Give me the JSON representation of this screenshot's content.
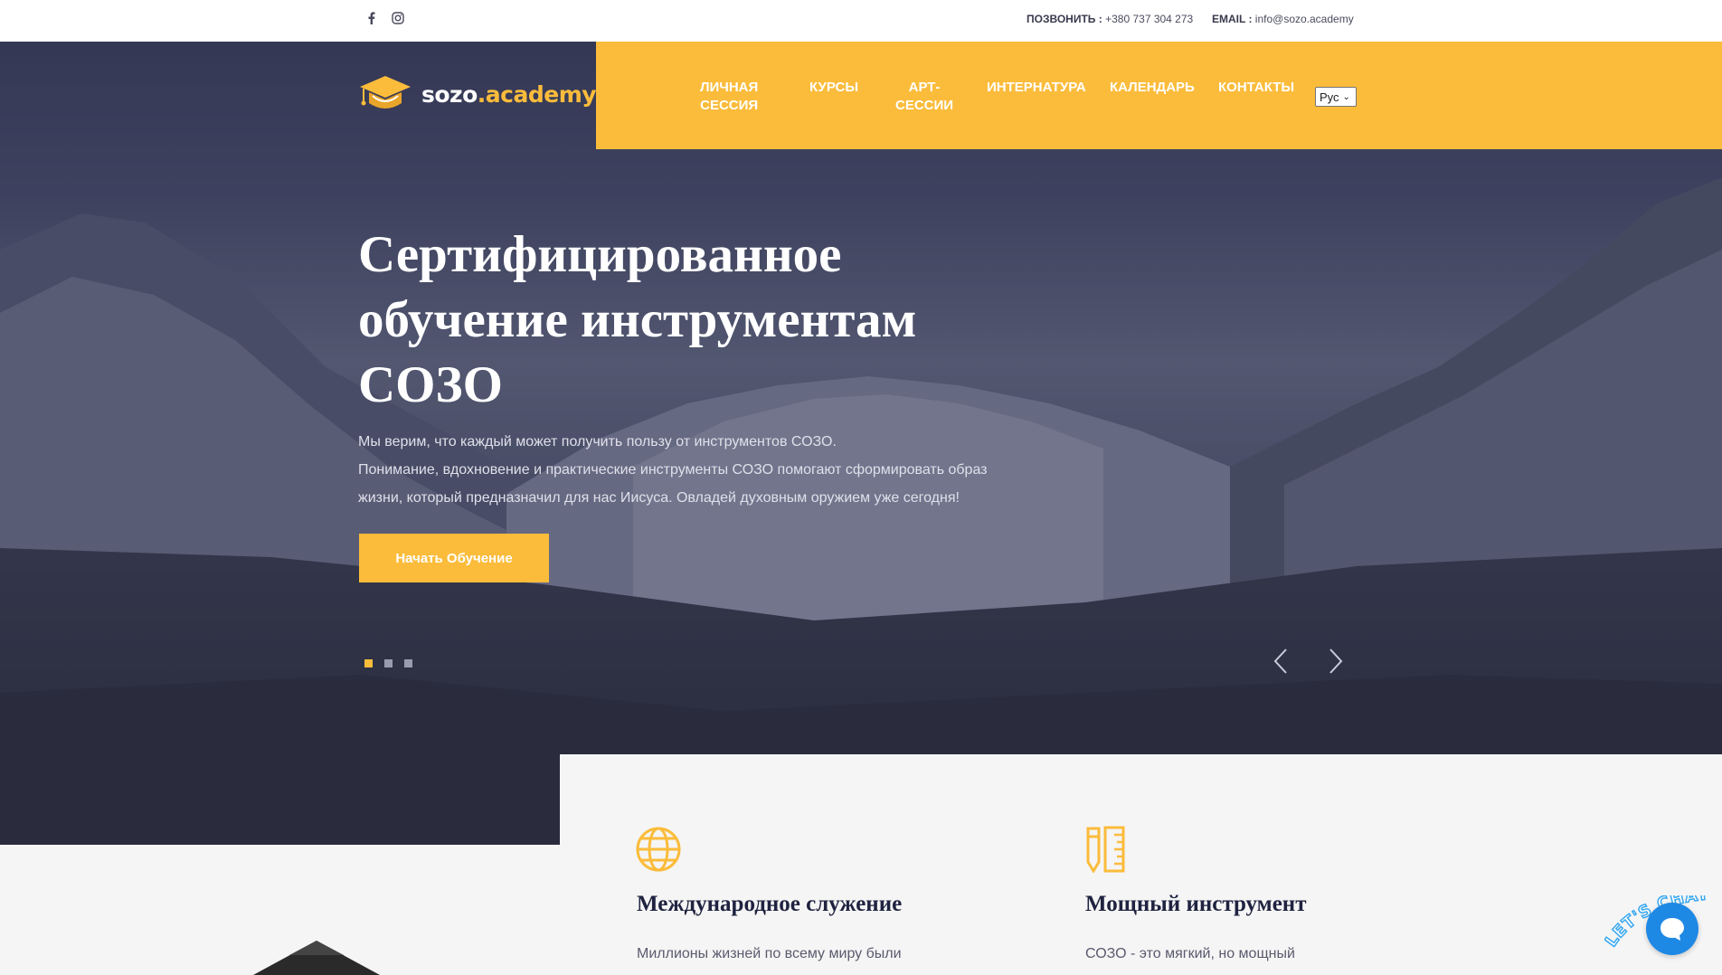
{
  "topbar": {
    "social": [
      {
        "icon": "facebook-icon"
      },
      {
        "icon": "instagram-icon"
      }
    ],
    "phone_label": "ПОЗВОНИТЬ :",
    "phone": "+380 737 304 273",
    "email_label": "EMAIL :",
    "email": "info@sozo.academy"
  },
  "brand": {
    "name": "sozo",
    "suffix": ".academy",
    "accent": "#fbbc3b"
  },
  "nav": {
    "items": [
      {
        "line1": "ЛИЧНАЯ",
        "line2": "СЕССИЯ"
      },
      {
        "line1": "КУРСЫ",
        "line2": ""
      },
      {
        "line1": "АРТ-",
        "line2": "СЕССИИ"
      },
      {
        "line1": "ИНТЕРНАТУРА",
        "line2": ""
      },
      {
        "line1": "КАЛЕНДАРЬ",
        "line2": ""
      },
      {
        "line1": "КОНТАКТЫ",
        "line2": ""
      }
    ],
    "language": "Рус"
  },
  "hero": {
    "title_line1": "Сертифицированное",
    "title_line2": "обучение инструментам",
    "title_line3": "СОЗО",
    "desc_line1": "Мы верим, что каждый может получить пользу от инструментов СОЗО.",
    "desc_line2": "Понимание, вдохновение и практические инструменты СОЗО помогают сформировать образ",
    "desc_line3": "жизни, который предназначил для нас Иисуса. Овладей духовным оружием уже сегодня!",
    "cta": "Начать Обучение",
    "slides": 3,
    "active_slide": 1
  },
  "features": [
    {
      "icon": "globe-icon",
      "title": "Международное служение",
      "text": "Миллионы жизней по всему миру были"
    },
    {
      "icon": "pencil-ruler-icon",
      "title": "Мощный инструмент",
      "text": "СОЗО - это мягкий, но мощный"
    }
  ],
  "chat": {
    "label": "LET'S CHAT!",
    "icon": "chat-bubble-icon",
    "color": "#1e88e5"
  }
}
